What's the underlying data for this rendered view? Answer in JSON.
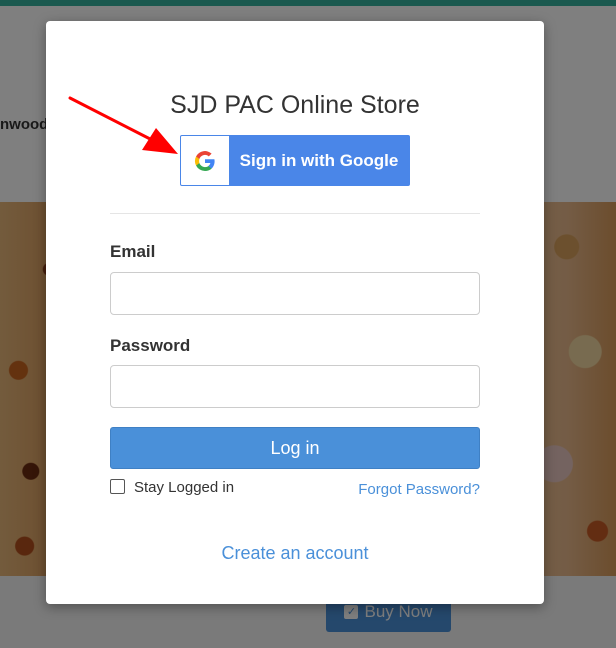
{
  "background": {
    "header_text": "nwood",
    "buy_button_label": "Buy Now"
  },
  "modal": {
    "title": "SJD PAC Online Store",
    "google_button_label": "Sign in with Google",
    "email_label": "Email",
    "email_value": "",
    "password_label": "Password",
    "password_value": "",
    "login_button_label": "Log in",
    "stay_logged_in_label": "Stay Logged in",
    "stay_logged_in_checked": false,
    "forgot_password_label": "Forgot Password?",
    "create_account_label": "Create an account"
  },
  "annotation": {
    "arrow_color": "#ff0000",
    "points_to": "google-sign-in-button"
  },
  "colors": {
    "accent": "#4a90d9",
    "google_blue": "#4a86e8",
    "topbar": "#36b39e"
  }
}
